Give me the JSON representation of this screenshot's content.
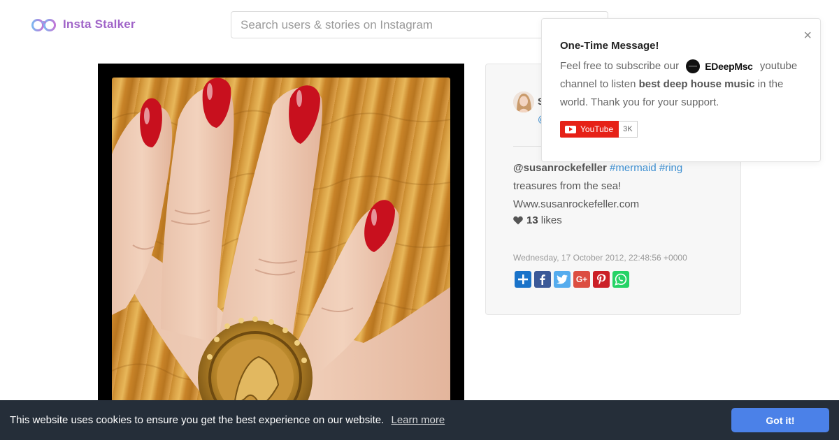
{
  "header": {
    "brand": "Insta Stalker",
    "search_placeholder": "Search users & stories on Instagram"
  },
  "post": {
    "user_name": "S",
    "user_handle": "@",
    "mention": "@susanrockefeller",
    "tags": [
      "#mermaid",
      "#ring"
    ],
    "caption_line2": "treasures from the sea!",
    "caption_line3": "Www.susanrockefeller.com",
    "likes_count": "13",
    "likes_label": "likes",
    "date": "Wednesday, 17 October 2012, 22:48:56 +0000",
    "share_icons": [
      {
        "name": "share-plus-icon",
        "color": "#1a73c9",
        "glyph": "+"
      },
      {
        "name": "facebook-icon",
        "color": "#3b5998",
        "glyph": "f"
      },
      {
        "name": "twitter-icon",
        "color": "#55acee",
        "glyph": "t"
      },
      {
        "name": "google-plus-icon",
        "color": "#dc4e41",
        "glyph": "G+"
      },
      {
        "name": "pinterest-icon",
        "color": "#cb2027",
        "glyph": "P"
      },
      {
        "name": "whatsapp-icon",
        "color": "#25d366",
        "glyph": "w"
      }
    ]
  },
  "popup": {
    "title": "One-Time Message!",
    "text_before": "Feel free to subscribe our",
    "brand": "EDeepMsc",
    "text_after": "youtube channel to listen",
    "bold_text": "best deep house music",
    "text_end": "in the world. Thank you for your support.",
    "youtube_label": "YouTube",
    "youtube_count": "3K",
    "close_glyph": "×"
  },
  "cookie": {
    "message": "This website uses cookies to ensure you get the best experience on our website.",
    "learn_more": "Learn more",
    "button": "Got it!"
  },
  "colors": {
    "brand": "#a064c8",
    "link": "#3d8fd1",
    "cookie_bg": "#252e39",
    "cookie_button": "#4b81e8"
  }
}
